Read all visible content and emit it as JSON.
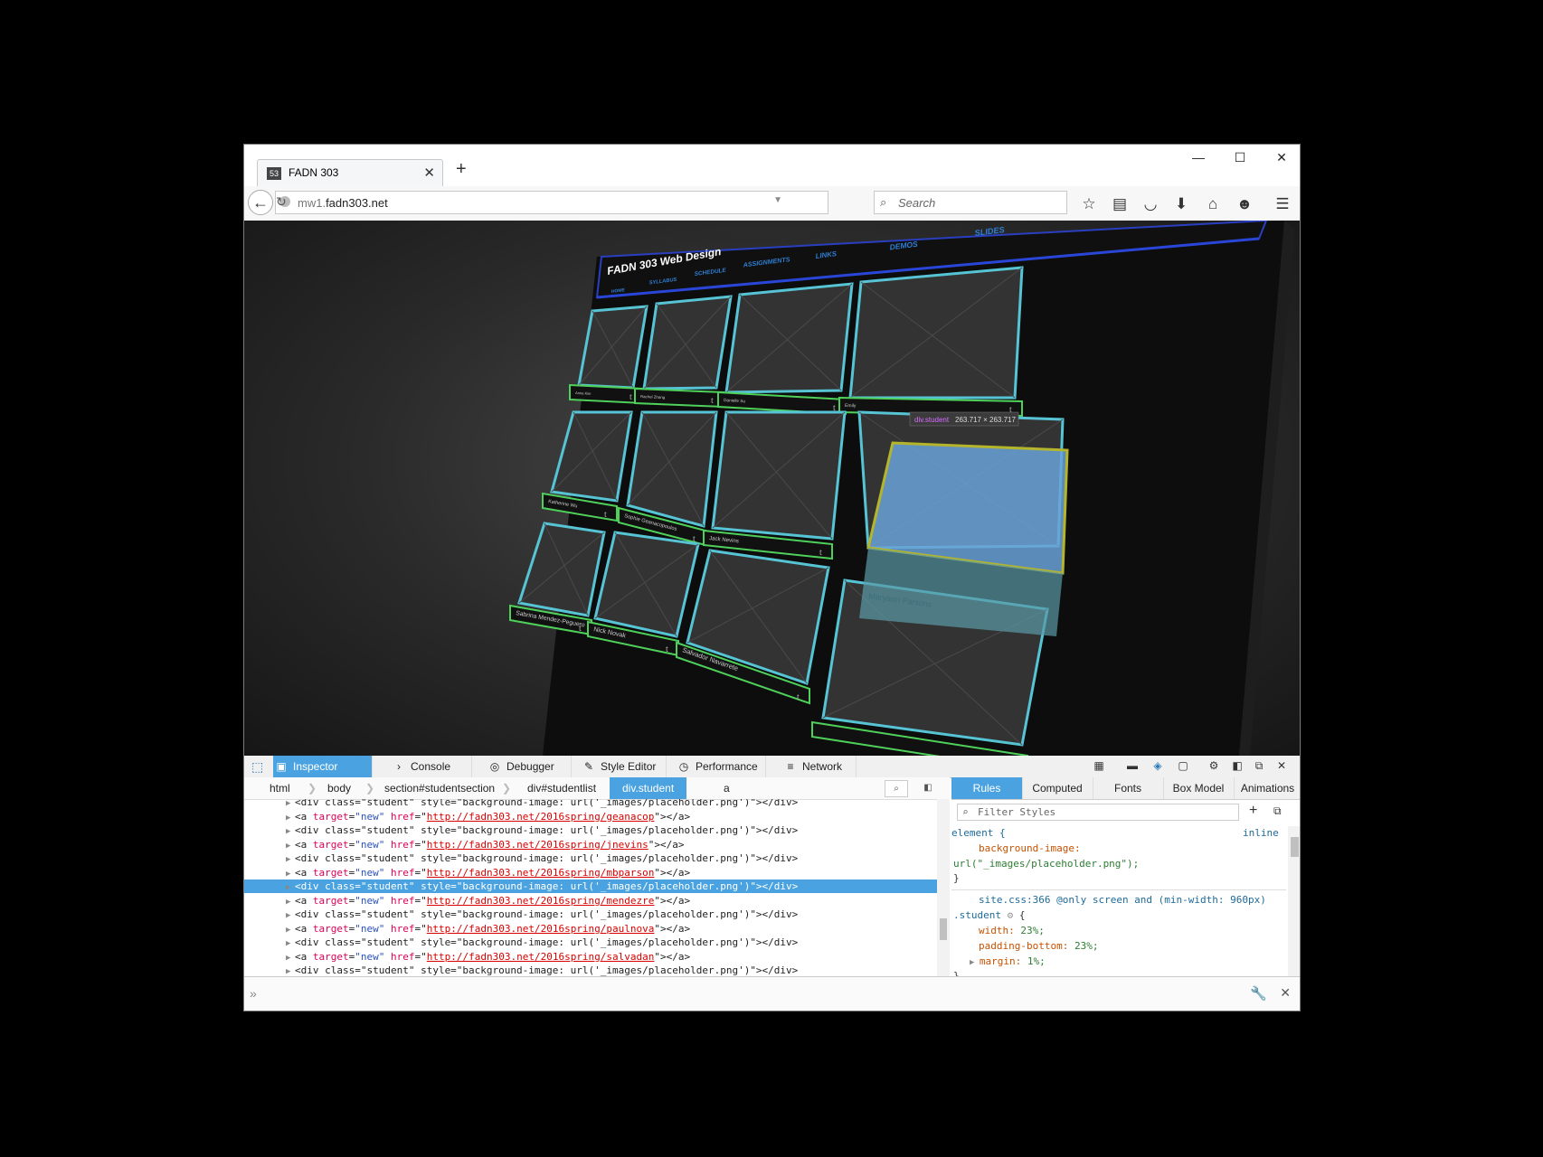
{
  "browser": {
    "tab_title": "FADN 303",
    "tab_favicon": "53",
    "tab_close": "✕",
    "new_tab": "+",
    "window_controls": {
      "minimize": "—",
      "maximize": "☐",
      "close": "✕"
    },
    "url_host": "mw1.",
    "url_domain": "fadn303.net",
    "search_placeholder": "Search",
    "toolbar_icons": [
      "star-icon",
      "reading-list-icon",
      "pocket-icon",
      "download-icon",
      "home-icon",
      "emoji-icon",
      "menu-icon"
    ]
  },
  "site": {
    "title": "FADN 303 Web Design",
    "nav": [
      "HOME",
      "SYLLABUS",
      "SCHEDULE",
      "ASSIGNMENTS",
      "LINKS",
      "DEMOS",
      "SLIDES"
    ],
    "students": [
      "Anna Kim",
      "Rachel Zhang",
      "Danielle Su",
      "Emily",
      "Katherine Wu",
      "Sophie Geanacopoulos",
      "Jack Nevins",
      "Maryann Parsons",
      "Sabrina Mendez-Peguero",
      "Nick Novak",
      "Salvador Navarrete",
      ""
    ],
    "tumblr_glyph": "t",
    "highlight_tooltip": {
      "selector": "div.student",
      "size": "263.717 × 263.717"
    }
  },
  "devtools": {
    "tabs": [
      "Inspector",
      "Console",
      "Debugger",
      "Style Editor",
      "Performance",
      "Network"
    ],
    "active_tab": "Inspector",
    "breadcrumbs": [
      {
        "tag": "html",
        "sel": ""
      },
      {
        "tag": "body",
        "sel": ""
      },
      {
        "tag": "section",
        "sel": "#studentsection"
      },
      {
        "tag": "div",
        "sel": "#studentlist"
      },
      {
        "tag": "div.student",
        "sel": ""
      },
      {
        "tag": "a",
        "sel": ""
      }
    ],
    "markup_lines": [
      {
        "kind": "div",
        "text": "<div class=\"student\" style=\"background-image: url('_images/placeholder.png')\"></div>"
      },
      {
        "kind": "a",
        "href": "http://fadn303.net/2016spring/geanacop"
      },
      {
        "kind": "div",
        "text": ""
      },
      {
        "kind": "a",
        "href": "http://fadn303.net/2016spring/jnevins"
      },
      {
        "kind": "div",
        "text": ""
      },
      {
        "kind": "a",
        "href": "http://fadn303.net/2016spring/mbparson"
      },
      {
        "kind": "div",
        "text": "",
        "selected": true
      },
      {
        "kind": "a",
        "href": "http://fadn303.net/2016spring/mendezre"
      },
      {
        "kind": "div",
        "text": ""
      },
      {
        "kind": "a",
        "href": "http://fadn303.net/2016spring/paulnova"
      },
      {
        "kind": "div",
        "text": ""
      },
      {
        "kind": "a",
        "href": "http://fadn303.net/2016spring/salvadan"
      },
      {
        "kind": "div",
        "text": ""
      }
    ],
    "rules_tabs": [
      "Rules",
      "Computed",
      "Fonts",
      "Box Model",
      "Animations"
    ],
    "filter_placeholder": "Filter Styles",
    "rules": {
      "element_selector": "element {",
      "element_source": "inline",
      "bg_prop": "background-image:",
      "bg_val": "url(\"_images/placeholder.png\");",
      "close": "}",
      "media_source": "site.css:366 @only screen and (min-width: 960px)",
      "student_selector": ".student",
      "open": "{",
      "props": [
        {
          "name": "width:",
          "value": "23%;"
        },
        {
          "name": "padding-bottom:",
          "value": "23%;"
        },
        {
          "name": "margin:",
          "value": "1%;"
        }
      ]
    },
    "console_prompt": "»"
  }
}
